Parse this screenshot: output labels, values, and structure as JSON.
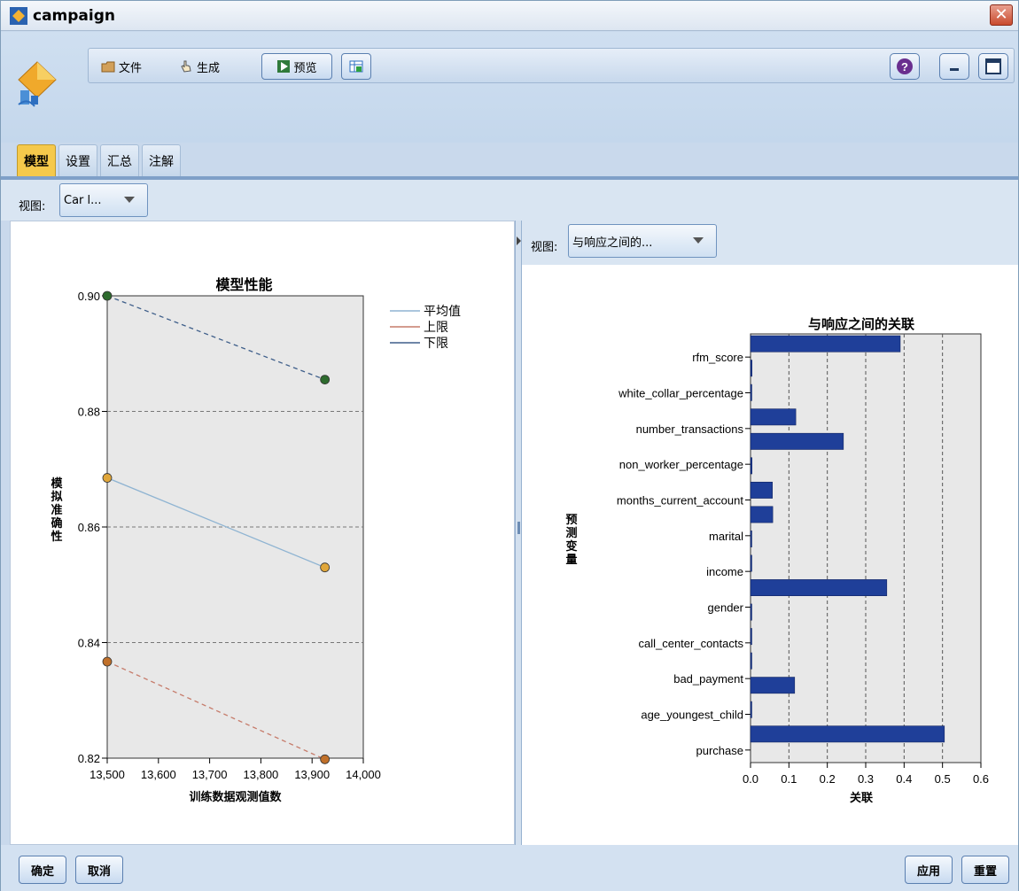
{
  "window": {
    "title": "campaign",
    "close": "✕"
  },
  "menu": {
    "file": "文件",
    "generate": "生成",
    "preview": "预览"
  },
  "tabs": [
    {
      "label": "模型",
      "active": true
    },
    {
      "label": "设置",
      "active": false
    },
    {
      "label": "汇总",
      "active": false
    },
    {
      "label": "注解",
      "active": false
    }
  ],
  "view": {
    "label": "视图:",
    "selected": "Car l..."
  },
  "right_view": {
    "label": "视图:",
    "selected": "与响应之间的..."
  },
  "buttons": {
    "ok": "确定",
    "cancel": "取消",
    "apply": "应用",
    "reset": "重置"
  },
  "colors": {
    "accent": "#f5c94b",
    "bar": "#1f3f99",
    "mean": "#8fb4d2",
    "upper": "#c67b6a",
    "lower": "#3f5f8a"
  },
  "chart_data": [
    {
      "type": "line",
      "title": "模型性能",
      "xlabel": "训练数据观测值数",
      "ylabel": "模拟准确性",
      "xlim": [
        13500,
        14000
      ],
      "ylim": [
        0.82,
        0.9
      ],
      "xticks": [
        "13,500",
        "13,600",
        "13,700",
        "13,800",
        "13,900",
        "14,000"
      ],
      "yticks": [
        "0.90",
        "0.88",
        "0.86",
        "0.84",
        "0.82"
      ],
      "legend": [
        "平均值",
        "上限",
        "下限"
      ],
      "series": [
        {
          "name": "平均值",
          "x": [
            13500,
            13925
          ],
          "values": [
            0.8685,
            0.853
          ]
        },
        {
          "name": "上限",
          "x": [
            13500,
            13925
          ],
          "values": [
            0.9,
            0.8855
          ]
        },
        {
          "name": "下限",
          "x": [
            13500,
            13925
          ],
          "values": [
            0.8367,
            0.8198
          ]
        }
      ]
    },
    {
      "type": "bar",
      "orientation": "horizontal",
      "title": "与响应之间的关联",
      "xlabel": "关联",
      "ylabel": "预测变量",
      "xlim": [
        0,
        0.6
      ],
      "xticks": [
        "0.0",
        "0.1",
        "0.2",
        "0.3",
        "0.4",
        "0.5",
        "0.6"
      ],
      "tick_labels": [
        "rfm_score",
        "white_collar_percentage",
        "number_transactions",
        "non_worker_percentage",
        "months_current_account",
        "marital",
        "income",
        "gender",
        "call_center_contacts",
        "bad_payment",
        "age_youngest_child",
        "purchase"
      ],
      "values": [
        0.39,
        0.004,
        0.003,
        0.118,
        0.242,
        0.004,
        0.057,
        0.058,
        0.0,
        0.0,
        0.355,
        0.0,
        0.003,
        0.0,
        0.115,
        0.0,
        0.505
      ]
    }
  ]
}
